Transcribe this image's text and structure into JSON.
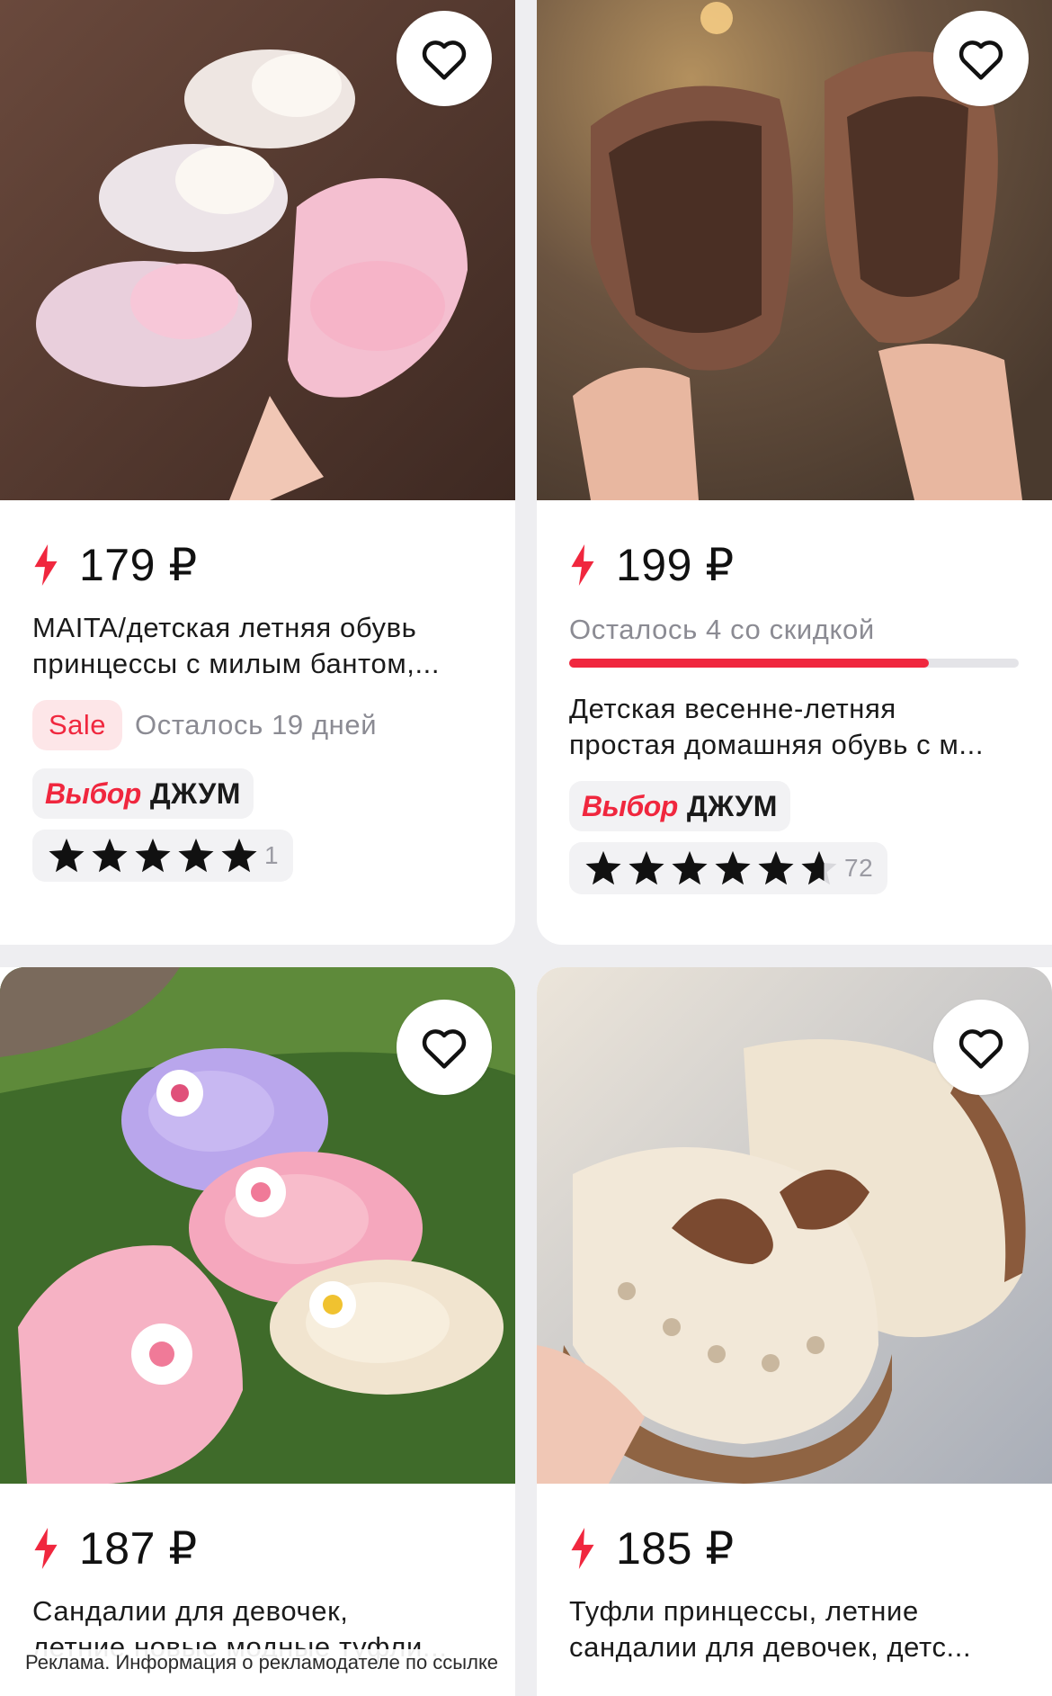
{
  "products": [
    {
      "price": "179 ₽",
      "title_line1": "MAITA/детская летняя обувь",
      "title_line2": "принцессы с милым бантом,...",
      "sale_label": "Sale",
      "days_left": "Осталось 19 дней",
      "choice_word1": "Выбор",
      "choice_word2": "ДЖУМ",
      "rating": 5,
      "rating_count": "1",
      "image_icon": "pink-white-bow-sandals-image"
    },
    {
      "price": "199 ₽",
      "remaining": "Осталось 4 со скидкой",
      "remaining_progress": 0.8,
      "title_line1": "Детская весенне-летняя",
      "title_line2": "простая домашняя обувь с м...",
      "choice_word1": "Выбор",
      "choice_word2": "ДЖУМ",
      "rating": 4.7,
      "rating_count": "72",
      "image_icon": "brown-kids-sandals-image"
    },
    {
      "price": "187 ₽",
      "title_line1": "Сандалии для девочек,",
      "title_line2": "летние новые модные туфли...",
      "image_icon": "flower-clog-sandals-image"
    },
    {
      "price": "185 ₽",
      "title_line1": "Туфли принцессы, летние",
      "title_line2": "сандалии для девочек, детс...",
      "image_icon": "beige-brown-bow-shoes-image"
    }
  ],
  "ad_notice": "Реклама. Информация о рекламодателе по ссылке",
  "colors": {
    "accent_red": "#f0273e",
    "muted_text": "#8b8b93",
    "chip_bg": "#f2f2f4",
    "page_bg": "#eeeef1"
  }
}
